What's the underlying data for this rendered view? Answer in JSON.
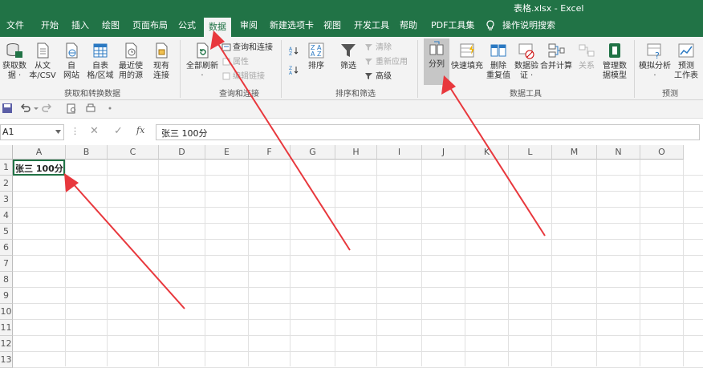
{
  "window": {
    "title": "表格.xlsx  -  Excel"
  },
  "tabs": [
    "文件",
    "开始",
    "插入",
    "绘图",
    "页面布局",
    "公式",
    "数据",
    "审阅",
    "新建选项卡",
    "视图",
    "开发工具",
    "帮助",
    "PDF工具集",
    "操作说明搜索"
  ],
  "active_tab": "数据",
  "ribbon": {
    "get_transform": {
      "buttons": [
        "获取数\n据 ·",
        "从文\n本/CSV",
        "自\n网站",
        "自表\n格/区域",
        "最近使\n用的源",
        "现有\n连接"
      ],
      "label": "获取和转换数据"
    },
    "queries": {
      "refresh_all": "全部刷新\n·",
      "small": [
        "查询和连接",
        "属性",
        "编辑链接"
      ],
      "label": "查询和连接"
    },
    "sort_filter": {
      "sort": "排序",
      "filter": "筛选",
      "small": [
        "清除",
        "重新应用",
        "高级"
      ],
      "label": "排序和筛选"
    },
    "data_tools": {
      "buttons": [
        "分列",
        "快速填充",
        "删除\n重复值",
        "数据验\n证 ·",
        "合并计算",
        "关系",
        "管理数\n据模型"
      ],
      "label": "数据工具"
    },
    "forecast": {
      "buttons": [
        "模拟分析\n·",
        "预测\n工作表"
      ],
      "label": "预测"
    }
  },
  "formula_bar": {
    "name_box": "A1",
    "fx_label": "fx",
    "value": "张三 100分"
  },
  "columns": [
    "A",
    "B",
    "C",
    "D",
    "E",
    "F",
    "G",
    "H",
    "I",
    "J",
    "K",
    "L",
    "M",
    "N",
    "O"
  ],
  "rows": [
    "1",
    "2",
    "3",
    "4",
    "5",
    "6",
    "7",
    "8",
    "9",
    "10",
    "11",
    "12",
    "13"
  ],
  "cells": {
    "A1": "张三 100分"
  },
  "colors": {
    "excel_green": "#217346",
    "arrow_red": "#e8383d",
    "ribbon_bg": "#f3f3f3"
  }
}
